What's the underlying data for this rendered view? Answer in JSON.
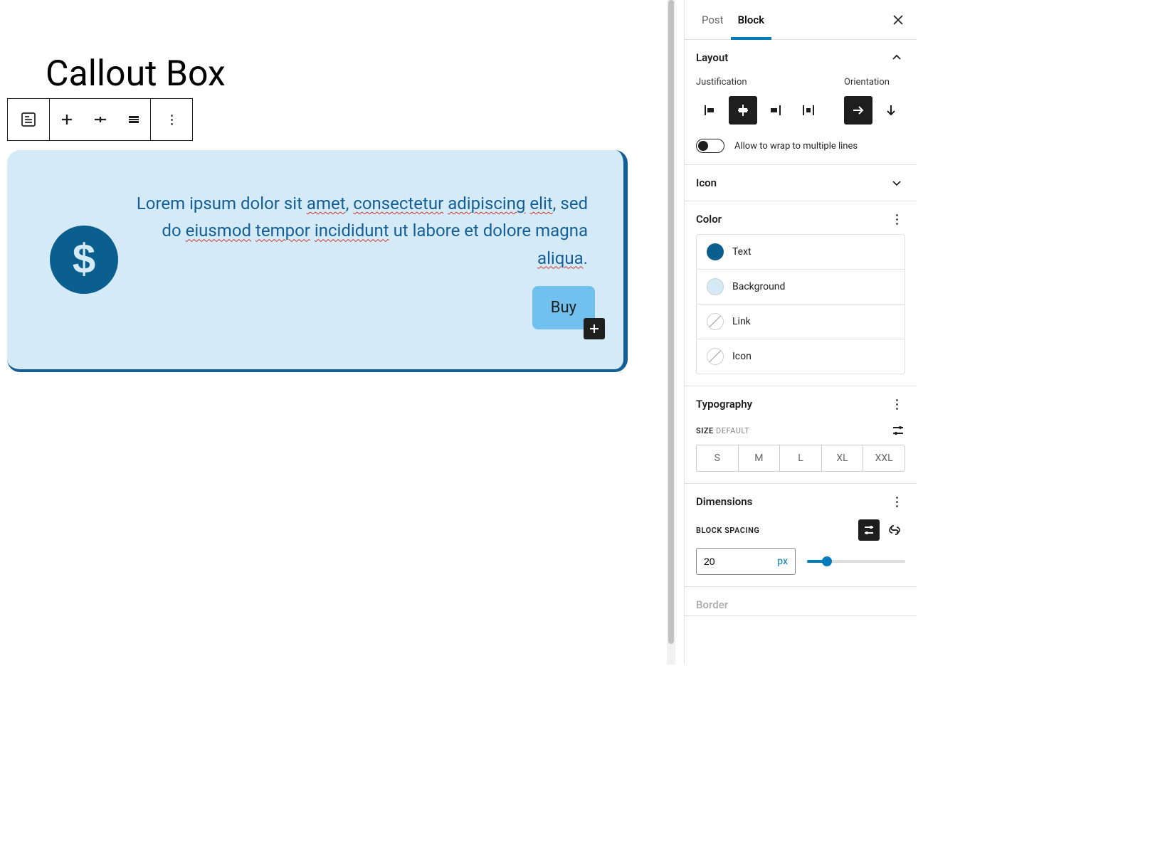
{
  "page": {
    "title": "Callout Box"
  },
  "callout": {
    "text_parts": [
      {
        "t": "Lorem ipsum dolor sit ",
        "u": false
      },
      {
        "t": "amet",
        "u": true
      },
      {
        "t": ", ",
        "u": false
      },
      {
        "t": "consectetur",
        "u": true
      },
      {
        "t": " ",
        "u": false
      },
      {
        "t": "adipiscing",
        "u": true
      },
      {
        "t": " ",
        "u": false
      },
      {
        "t": "elit",
        "u": true
      },
      {
        "t": ", sed do ",
        "u": false
      },
      {
        "t": "eiusmod",
        "u": true
      },
      {
        "t": " ",
        "u": false
      },
      {
        "t": "tempor",
        "u": true
      },
      {
        "t": " ",
        "u": false
      },
      {
        "t": "incididunt",
        "u": true
      },
      {
        "t": " ut labore et dolore magna ",
        "u": false
      },
      {
        "t": "aliqua",
        "u": true
      },
      {
        "t": ".",
        "u": false
      }
    ],
    "button_label": "Buy",
    "icon": "dollar-sign",
    "colors": {
      "text": "#135e96",
      "background": "#d4eaf6",
      "accent": "#72c0ee",
      "icon_bg": "#0a5f8f"
    }
  },
  "sidebar": {
    "tabs": {
      "post": "Post",
      "block": "Block",
      "active": "block"
    },
    "layout": {
      "title": "Layout",
      "justification_label": "Justification",
      "orientation_label": "Orientation",
      "wrap_label": "Allow to wrap to multiple lines",
      "wrap_on": false
    },
    "icon_panel": {
      "title": "Icon"
    },
    "color": {
      "title": "Color",
      "items": [
        {
          "label": "Text",
          "swatch": "sw-text"
        },
        {
          "label": "Background",
          "swatch": "sw-bg"
        },
        {
          "label": "Link",
          "swatch": "sw-none"
        },
        {
          "label": "Icon",
          "swatch": "sw-none"
        }
      ]
    },
    "typography": {
      "title": "Typography",
      "size_label": "SIZE",
      "size_default": "DEFAULT",
      "sizes": [
        "S",
        "M",
        "L",
        "XL",
        "XXL"
      ]
    },
    "dimensions": {
      "title": "Dimensions",
      "block_spacing_label": "BLOCK SPACING",
      "value": "20",
      "unit": "px"
    },
    "border": {
      "title": "Border"
    }
  }
}
